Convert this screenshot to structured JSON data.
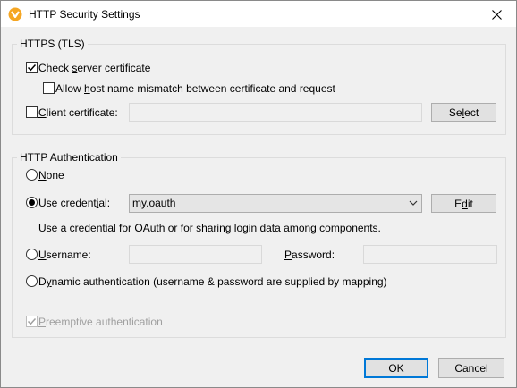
{
  "window": {
    "title": "HTTP Security Settings"
  },
  "https_group": {
    "label": "HTTPS (TLS)",
    "check_server_cert": {
      "pre": "Check ",
      "u": "s",
      "post": "erver certificate",
      "checked": true
    },
    "allow_mismatch": {
      "pre": "Allow ",
      "u": "h",
      "post": "ost name mismatch between certificate and request",
      "checked": false
    },
    "client_cert": {
      "pre": "",
      "u": "C",
      "post": "lient certificate:",
      "checked": false,
      "value": ""
    },
    "select_button": {
      "pre": "Se",
      "u": "l",
      "post": "ect"
    }
  },
  "auth_group": {
    "label": "HTTP Authentication",
    "none": {
      "pre": "",
      "u": "N",
      "post": "one",
      "selected": false
    },
    "use_credential": {
      "pre": "Use credent",
      "u": "i",
      "post": "al:",
      "selected": true
    },
    "credential_value": "my.oauth",
    "edit_button": {
      "pre": "E",
      "u": "d",
      "post": "it"
    },
    "hint": "Use a credential for OAuth or for sharing login data among components.",
    "username": {
      "pre": "",
      "u": "U",
      "post": "sername:",
      "selected": false,
      "value": ""
    },
    "password": {
      "pre": "",
      "u": "P",
      "post": "assword:",
      "value": ""
    },
    "dynamic": {
      "pre": "D",
      "u": "y",
      "post": "namic authentication (username & password are supplied by mapping)",
      "selected": false
    },
    "preemptive": {
      "pre": "",
      "u": "P",
      "post": "reemptive authentication",
      "checked": true,
      "disabled": true
    }
  },
  "footer": {
    "ok_label": "OK",
    "cancel_label": "Cancel"
  },
  "icons": {
    "app": "altova-app-icon",
    "close": "close-icon",
    "dropdown": "chevron-down-icon"
  },
  "colors": {
    "app_icon": "#f5a623",
    "accent": "#0078d7",
    "dialog_bg": "#f0f0f0"
  }
}
